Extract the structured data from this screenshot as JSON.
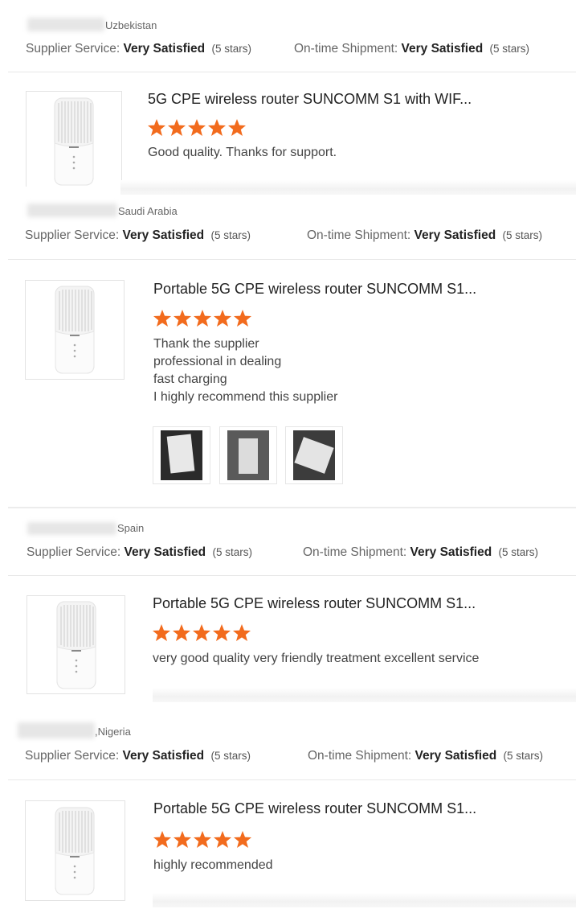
{
  "labels": {
    "supplier_service": "Supplier Service:",
    "ontime_shipment": "On-time Shipment:",
    "rating_text": "Very Satisfied",
    "rating_count": "(5 stars)"
  },
  "colors": {
    "star": "#f26b1d",
    "accent": "#f26b1d"
  },
  "reviews": [
    {
      "country": "Uzbekistan",
      "product_title": "5G CPE wireless router SUNCOMM S1 with WIF...",
      "stars": 5,
      "comment": [
        "Good quality. Thanks for support."
      ]
    },
    {
      "country": "Saudi Arabia",
      "product_title": "Portable 5G CPE wireless router SUNCOMM S1...",
      "stars": 5,
      "comment": [
        "Thank the supplier",
        "professional in dealing",
        "fast charging",
        "I highly recommend this supplier"
      ],
      "photos": 3
    },
    {
      "country": "Spain",
      "product_title": "Portable 5G CPE wireless router SUNCOMM S1...",
      "stars": 5,
      "comment": [
        "very good quality very friendly treatment excellent service"
      ]
    },
    {
      "country": ",Nigeria",
      "product_title": "Portable 5G CPE wireless router SUNCOMM S1...",
      "stars": 5,
      "comment": [
        "highly recommended"
      ]
    }
  ]
}
